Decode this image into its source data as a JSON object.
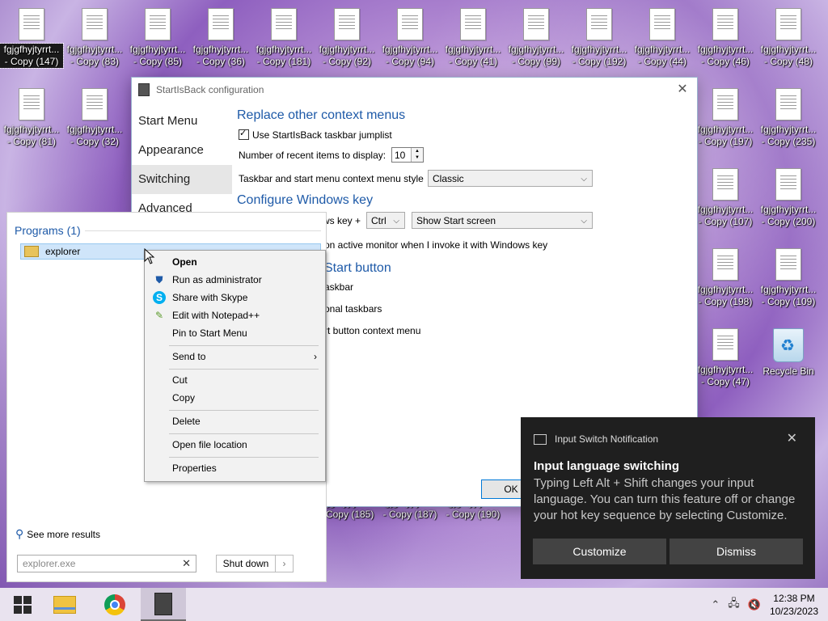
{
  "desktop": {
    "icons": [
      {
        "label": "fgjgfhyjtyrrt...\n- Copy (147)",
        "selected": true
      },
      {
        "label": "fgjgfhyjtyrrt...\n- Copy (83)"
      },
      {
        "label": "fgjgfhyjtyrrt...\n- Copy (85)"
      },
      {
        "label": "fgjgfhyjtyrrt...\n- Copy (36)"
      },
      {
        "label": "fgjgfhyjtyrrt...\n- Copy (181)"
      },
      {
        "label": "fgjgfhyjtyrrt...\n- Copy (92)"
      },
      {
        "label": "fgjgfhyjtyrrt...\n- Copy (94)"
      },
      {
        "label": "fgjgfhyjtyrrt...\n- Copy (41)"
      },
      {
        "label": "fgjgfhyjtyrrt...\n- Copy (99)"
      },
      {
        "label": "fgjgfhyjtyrrt...\n- Copy (192)"
      },
      {
        "label": "fgjgfhyjtyrrt...\n- Copy (44)"
      },
      {
        "label": "fgjgfhyjtyrrt...\n- Copy (46)"
      },
      {
        "label": "fgjgfhyjtyrrt...\n- Copy (48)"
      },
      {
        "label": "fgjgfhyjtyrrt...\n- Copy (81)"
      },
      {
        "label": "fgjgfhyjtyrrt...\n- Copy (32)"
      },
      {
        "label": "fgjgfhyjtyrrt...\n- Copy (197)"
      },
      {
        "label": "fgjgfhyjtyrrt...\n- Copy (235)"
      },
      {
        "label": "fgjgfhyjtyrrt...\n- Copy (107)"
      },
      {
        "label": "fgjgfhyjtyrrt...\n- Copy (200)"
      },
      {
        "label": "fgjgfhyjtyrrt...\n- Copy (198)"
      },
      {
        "label": "fgjgfhyjtyrrt...\n- Copy (109)"
      },
      {
        "label": "fgjgfhyjtyrrt...\n- Copy (47)"
      },
      {
        "label": "Recycle Bin"
      },
      {
        "label": "fgjgfhyjtyrrt...\n- Copy (185)"
      },
      {
        "label": "fgjgfhyjtyrrt...\n- Copy (187)"
      },
      {
        "label": "fgjgfhyjtyrrt...\n- Copy (190)"
      }
    ]
  },
  "config_window": {
    "title": "StartIsBack configuration",
    "close": "✕",
    "nav": [
      "Start Menu",
      "Appearance",
      "Switching",
      "Advanced"
    ],
    "section1": "Replace other context menus",
    "use_jumplist": "Use StartIsBack taskbar jumplist",
    "recent_items_label": "Number of recent items to display:",
    "recent_items_value": "10",
    "context_style_label": "Taskbar and start menu context menu style",
    "context_style_value": "Classic",
    "section2": "Configure Windows key",
    "winkey_label": "ws key +",
    "winkey_mod": "Ctrl",
    "winkey_action": "Show Start screen",
    "active_monitor": "on active monitor when I invoke it with Windows key",
    "section3": "Start button",
    "opt1": "askbar",
    "opt2": "onal taskbars",
    "opt3": "rt button context menu",
    "ok": "OK"
  },
  "start_menu": {
    "programs_header": "Programs (1)",
    "result": "explorer",
    "see_more": "See more results",
    "search_value": "explorer.exe",
    "search_clear": "✕",
    "shutdown": "Shut down",
    "shutdown_arrow": "›"
  },
  "context_menu": {
    "open": "Open",
    "run_admin": "Run as administrator",
    "skype": "Share with Skype",
    "notepad": "Edit with Notepad++",
    "pin": "Pin to Start Menu",
    "send_to": "Send to",
    "cut": "Cut",
    "copy": "Copy",
    "delete": "Delete",
    "open_location": "Open file location",
    "properties": "Properties"
  },
  "notification": {
    "header": "Input Switch Notification",
    "title": "Input language switching",
    "body": "Typing Left Alt + Shift changes your input language. You can turn this feature off or change your hot key sequence by selecting Customize.",
    "customize": "Customize",
    "dismiss": "Dismiss",
    "close": "✕"
  },
  "taskbar": {
    "time": "12:38 PM",
    "date": "10/23/2023"
  }
}
